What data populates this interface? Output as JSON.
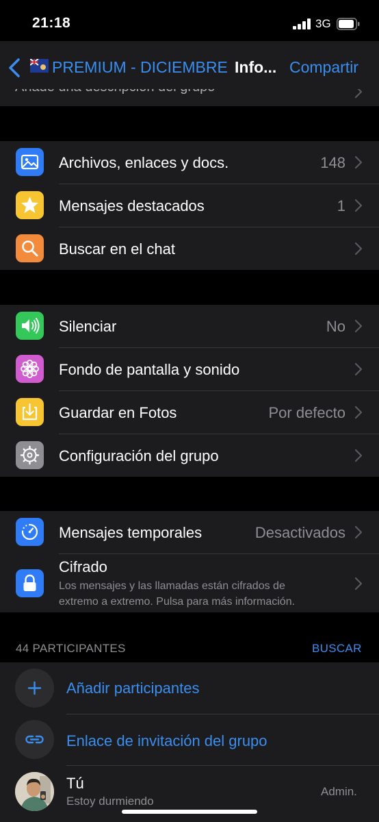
{
  "status": {
    "time": "21:18",
    "network": "3G"
  },
  "nav": {
    "group_name": "PREMIUM - DICIEMBRE",
    "title": "Info...",
    "share": "Compartir"
  },
  "description_partial": "Añade una descripción del grupo",
  "media": [
    {
      "label": "Archivos, enlaces y docs.",
      "value": "148",
      "icon": "photo-icon",
      "color": "#2f7cf6"
    },
    {
      "label": "Mensajes destacados",
      "value": "1",
      "icon": "star-icon",
      "color": "#f7c531"
    },
    {
      "label": "Buscar en el chat",
      "value": "",
      "icon": "search-icon",
      "color": "#f28b3c"
    }
  ],
  "settings": [
    {
      "label": "Silenciar",
      "value": "No",
      "icon": "speaker-icon",
      "color": "#34c759"
    },
    {
      "label": "Fondo de pantalla y sonido",
      "value": "",
      "icon": "flower-icon",
      "color": "#d05ccf"
    },
    {
      "label": "Guardar en Fotos",
      "value": "Por defecto",
      "icon": "download-icon",
      "color": "#f7c531"
    },
    {
      "label": "Configuración del grupo",
      "value": "",
      "icon": "gear-icon",
      "color": "#8e8e93"
    }
  ],
  "privacy": {
    "temporary_label": "Mensajes temporales",
    "temporary_value": "Desactivados",
    "encryption_label": "Cifrado",
    "encryption_line1": "Los mensajes y las llamadas están cifrados de",
    "encryption_line2": "extremo a extremo. Pulsa para más información.",
    "temporary_color": "#2f7cf6",
    "encryption_color": "#2f7cf6"
  },
  "participants": {
    "header": "44 PARTICIPANTES",
    "search": "BUSCAR",
    "add": "Añadir participantes",
    "invite": "Enlace de invitación del grupo",
    "me_name": "Tú",
    "me_status": "Estoy durmiendo",
    "me_role": "Admin."
  },
  "colors": {
    "accent": "#3a8ef0",
    "background": "#000000",
    "cell": "#1c1c1e"
  }
}
